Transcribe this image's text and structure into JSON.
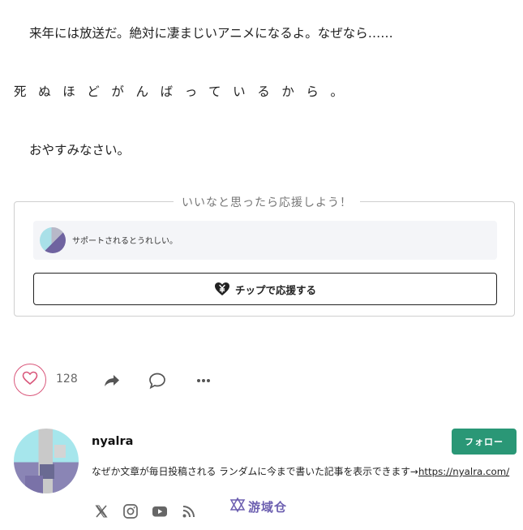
{
  "article": {
    "paragraph1": "来年には放送だ。絶対に凄まじいアニメになるよ。なぜなら……",
    "paragraph2": "死ぬほどがんばっているから。",
    "paragraph3": "おやすみなさい。"
  },
  "support": {
    "legend": "いいなと思ったら応援しよう！",
    "message": "サポートされるとうれしい。",
    "tip_button_label": "チップで応援する"
  },
  "actions": {
    "like_count": "128",
    "like_color": "#d9567a"
  },
  "profile": {
    "name": "nyalra",
    "follow_label": "フォロー",
    "follow_color": "#2a9776",
    "bio_text": "なぜか文章が毎日投稿される ランダムに今まで書いた記事を表示できます→",
    "bio_link": "https://nyalra.com/",
    "social_icons": [
      "x-icon",
      "instagram-icon",
      "youtube-icon",
      "rss-icon"
    ]
  },
  "watermark": {
    "text": "游域仓"
  }
}
